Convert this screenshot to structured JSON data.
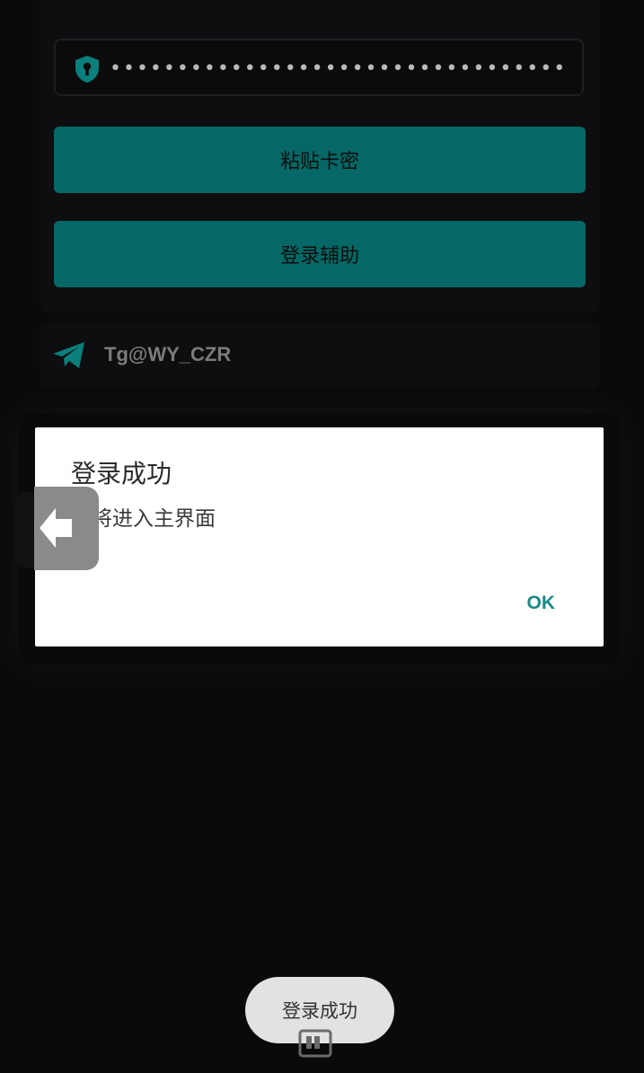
{
  "login": {
    "password_mask": "••••••••••••••••••••••••••••••••••",
    "paste_button": "粘贴卡密",
    "login_button": "登录辅助"
  },
  "contact": {
    "telegram": "Tg@WY_CZR"
  },
  "dialog": {
    "title": "登录成功",
    "message": "即将进入主界面",
    "ok": "OK"
  },
  "toast": {
    "text": "登录成功"
  },
  "colors": {
    "accent": "#056866",
    "ok_text": "#1a8a86",
    "background": "#0a0a0b"
  },
  "icons": {
    "password": "shield-key-icon",
    "telegram": "telegram-plane-icon",
    "back": "back-arrow-icon",
    "nav": "bottom-nav-icon"
  }
}
